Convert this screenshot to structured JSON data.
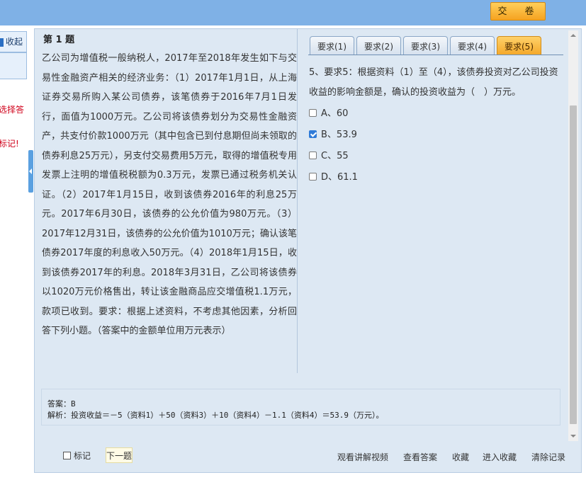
{
  "topbar": {
    "submit_label": "交　卷"
  },
  "left_panel": {
    "collapse_label": "收起",
    "note1": "选择答",
    "note2": "标记!"
  },
  "question": {
    "title": "第 1 题",
    "body": "乙公司为增值税一般纳税人，2017年至2018年发生如下与交易性金融资产相关的经济业务：（1）2017年1月1日，从上海证券交易所购入某公司债券，该笔债券于2016年7月1日发行，面值为1000万元。乙公司将该债券划分为交易性金融资产，共支付价款1000万元（其中包含已到付息期但尚未领取的债券利息25万元），另支付交易费用5万元，取得的增值税专用发票上注明的增值税税额为0.3万元，发票已通过税务机关认证。（2）2017年1月15日，收到该债券2016年的利息25万元。2017年6月30日，该债券的公允价值为980万元。（3）2017年12月31日，该债券的公允价值为1010万元；确认该笔债券2017年度的利息收入50万元。（4）2018年1月15日，收到该债券2017年的利息。2018年3月31日，乙公司将该债券以1020万元价格售出，转让该金融商品应交增值税1.1万元，款项已收到。要求：根据上述资料，不考虑其他因素，分析回答下列小题。（答案中的金额单位用万元表示）"
  },
  "tabs": [
    {
      "label": "要求(1)"
    },
    {
      "label": "要求(2)"
    },
    {
      "label": "要求(3)"
    },
    {
      "label": "要求(4)"
    },
    {
      "label": "要求(5)"
    }
  ],
  "active_tab": "要求(5)",
  "sub_question": {
    "text": "5、要求5：根据资料（1）至（4），该债券投资对乙公司投资收益的影响金额是，确认的投资收益为（　）万元。",
    "options": [
      {
        "label": "A、60",
        "checked": false
      },
      {
        "label": "B、53.9",
        "checked": true
      },
      {
        "label": "C、55",
        "checked": false
      },
      {
        "label": "D、61.1",
        "checked": false
      }
    ]
  },
  "answer": {
    "answer_line": "答案：B",
    "analysis_line": "解析：投资收益＝－5（资料1）＋50（资料3）＋10（资料4）－1.1（资料4）＝53.9（万元）。"
  },
  "footer": {
    "mark_label": "标记",
    "next_label": "下一题",
    "links": [
      "观看讲解视频",
      "查看答案",
      "收藏",
      "进入收藏",
      "清除记录"
    ]
  },
  "colors": {
    "topbar": "#7fb1e6",
    "panel": "#dde8f3",
    "active_tab": "#f4a92b"
  }
}
